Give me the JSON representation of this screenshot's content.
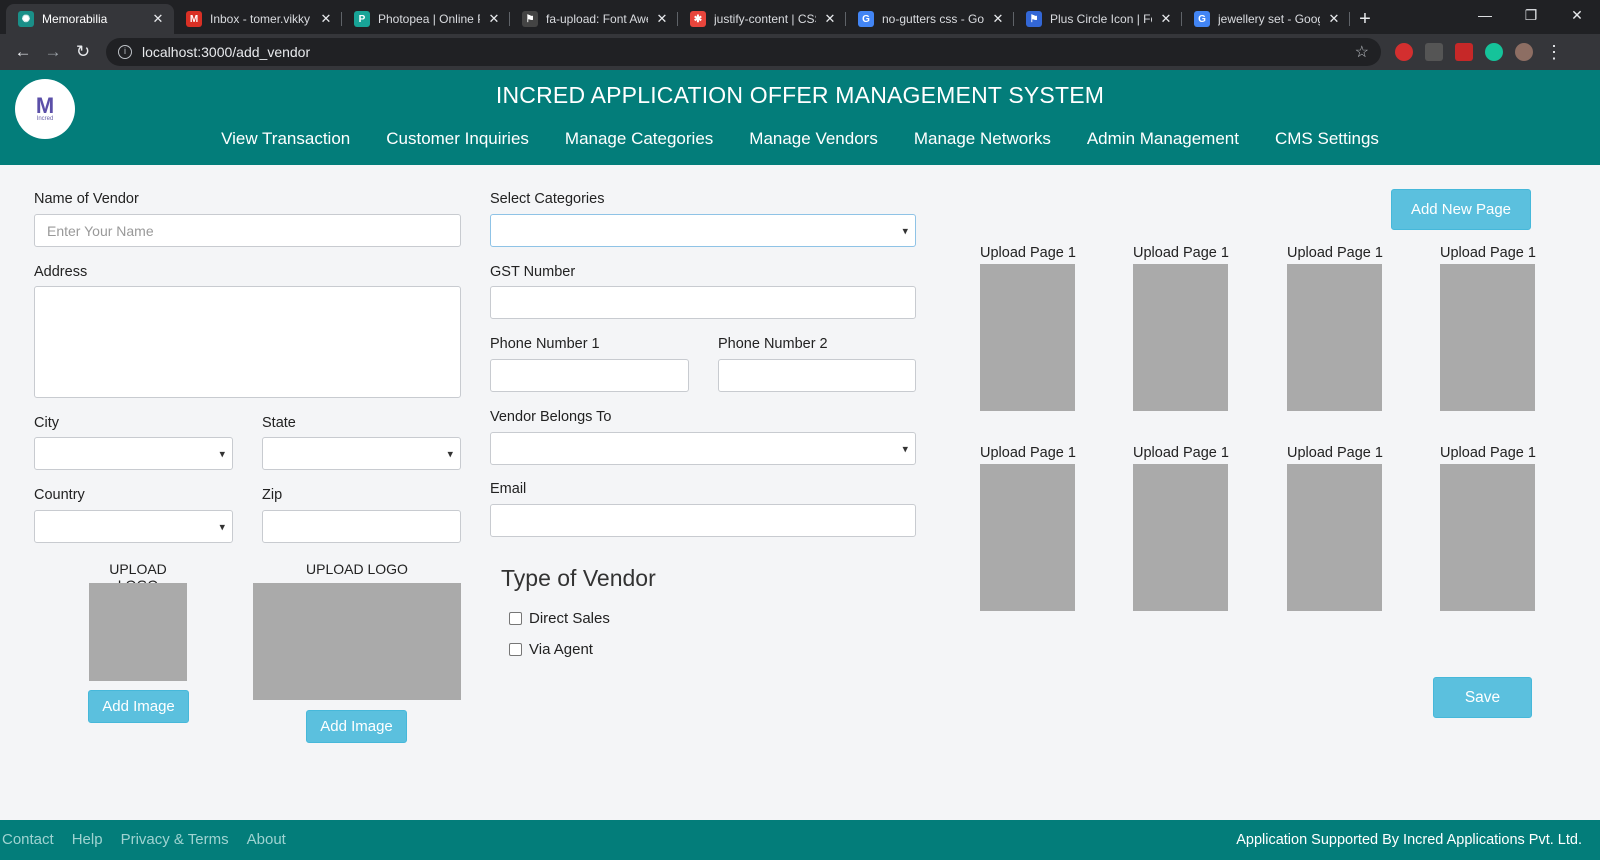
{
  "browser": {
    "tabs": [
      {
        "title": "Memorabilia",
        "color": "#1a8f88",
        "glyph": "✺",
        "active": true
      },
      {
        "title": "Inbox - tomer.vikky",
        "color": "#d93025",
        "glyph": "M"
      },
      {
        "title": "Photopea | Online P",
        "color": "#18a497",
        "glyph": "P"
      },
      {
        "title": "fa-upload: Font Awe",
        "color": "#444",
        "glyph": "⚑"
      },
      {
        "title": "justify-content | CSS",
        "color": "#e8453c",
        "glyph": "✱"
      },
      {
        "title": "no-gutters css - Goo",
        "color": "#4285f4",
        "glyph": "G"
      },
      {
        "title": "Plus Circle Icon | For",
        "color": "#3367d6",
        "glyph": "⚑"
      },
      {
        "title": "jewellery set - Goog",
        "color": "#4285f4",
        "glyph": "G"
      }
    ],
    "url": "localhost:3000/add_vendor"
  },
  "header": {
    "title": "INCRED APPLICATION OFFER MANAGEMENT SYSTEM",
    "logo_text": "Incred",
    "nav": [
      "View Transaction",
      "Customer Inquiries",
      "Manage Categories",
      "Manage Vendors",
      "Manage Networks",
      "Admin Management",
      "CMS Settings"
    ]
  },
  "form": {
    "name_label": "Name of Vendor",
    "name_placeholder": "Enter Your Name",
    "address_label": "Address",
    "city_label": "City",
    "state_label": "State",
    "country_label": "Country",
    "zip_label": "Zip",
    "upload_logo_1": "UPLOAD LOGO",
    "upload_logo_2": "UPLOAD LOGO",
    "add_image_1": "Add Image",
    "add_image_2": "Add Image",
    "categories_label": "Select Categories",
    "gst_label": "GST Number",
    "phone1_label": "Phone Number 1",
    "phone2_label": "Phone Number 2",
    "belongs_label": "Vendor Belongs To",
    "email_label": "Email",
    "type_heading": "Type of Vendor",
    "type_direct": "Direct Sales",
    "type_agent": "Via Agent"
  },
  "pages": {
    "add_new_page": "Add New Page",
    "labels": [
      "Upload Page 1",
      "Upload Page 1",
      "Upload Page 1",
      "Upload Page 1",
      "Upload Page 1",
      "Upload Page 1",
      "Upload Page 1",
      "Upload Page 1"
    ],
    "save": "Save"
  },
  "footer": {
    "links": [
      "Contact",
      "Help",
      "Privacy & Terms",
      "About"
    ],
    "support": "Application Supported By Incred Applications Pvt. Ltd."
  }
}
